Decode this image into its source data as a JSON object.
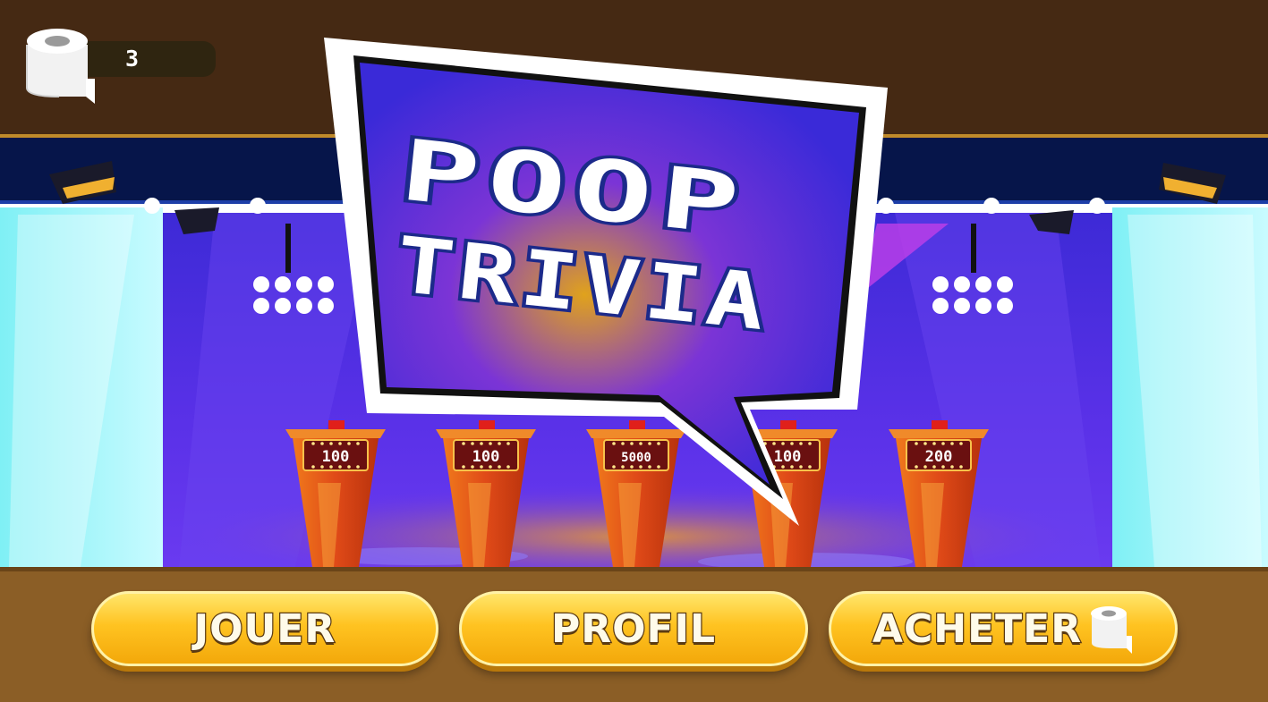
{
  "hud": {
    "roll_count": "3",
    "roll_icon": "toilet-paper-roll-icon"
  },
  "title": {
    "line1": "POOP",
    "line2": "TRIVIA"
  },
  "podiums": [
    {
      "score": "100"
    },
    {
      "score": "100"
    },
    {
      "score": "5000"
    },
    {
      "score": "100"
    },
    {
      "score": "200"
    }
  ],
  "menu": {
    "play_label": "JOUER",
    "profile_label": "PROFIL",
    "buy_label": "ACHETER",
    "buy_icon": "toilet-paper-roll-icon"
  },
  "colors": {
    "stage_purple": "#4a2fe0",
    "ceiling_brown": "#452913",
    "floor_brown": "#8b5e26",
    "podium_orange": "#e04a18",
    "button_yellow": "#ffc321",
    "bubble_blue": "#3a2ad8"
  }
}
